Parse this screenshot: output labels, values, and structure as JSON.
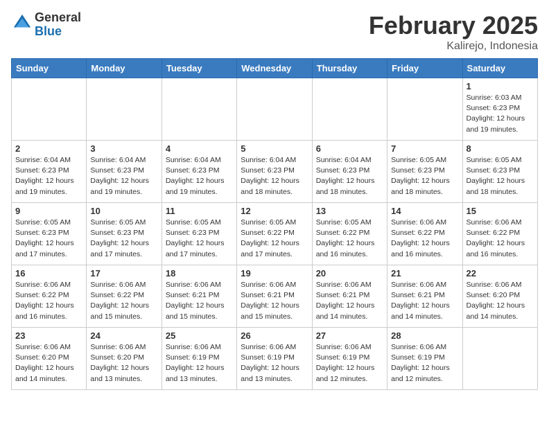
{
  "header": {
    "logo_line1": "General",
    "logo_line2": "Blue",
    "month_title": "February 2025",
    "location": "Kalirejo, Indonesia"
  },
  "days_of_week": [
    "Sunday",
    "Monday",
    "Tuesday",
    "Wednesday",
    "Thursday",
    "Friday",
    "Saturday"
  ],
  "weeks": [
    [
      {
        "day": "",
        "info": ""
      },
      {
        "day": "",
        "info": ""
      },
      {
        "day": "",
        "info": ""
      },
      {
        "day": "",
        "info": ""
      },
      {
        "day": "",
        "info": ""
      },
      {
        "day": "",
        "info": ""
      },
      {
        "day": "1",
        "info": "Sunrise: 6:03 AM\nSunset: 6:23 PM\nDaylight: 12 hours\nand 19 minutes."
      }
    ],
    [
      {
        "day": "2",
        "info": "Sunrise: 6:04 AM\nSunset: 6:23 PM\nDaylight: 12 hours\nand 19 minutes."
      },
      {
        "day": "3",
        "info": "Sunrise: 6:04 AM\nSunset: 6:23 PM\nDaylight: 12 hours\nand 19 minutes."
      },
      {
        "day": "4",
        "info": "Sunrise: 6:04 AM\nSunset: 6:23 PM\nDaylight: 12 hours\nand 19 minutes."
      },
      {
        "day": "5",
        "info": "Sunrise: 6:04 AM\nSunset: 6:23 PM\nDaylight: 12 hours\nand 18 minutes."
      },
      {
        "day": "6",
        "info": "Sunrise: 6:04 AM\nSunset: 6:23 PM\nDaylight: 12 hours\nand 18 minutes."
      },
      {
        "day": "7",
        "info": "Sunrise: 6:05 AM\nSunset: 6:23 PM\nDaylight: 12 hours\nand 18 minutes."
      },
      {
        "day": "8",
        "info": "Sunrise: 6:05 AM\nSunset: 6:23 PM\nDaylight: 12 hours\nand 18 minutes."
      }
    ],
    [
      {
        "day": "9",
        "info": "Sunrise: 6:05 AM\nSunset: 6:23 PM\nDaylight: 12 hours\nand 17 minutes."
      },
      {
        "day": "10",
        "info": "Sunrise: 6:05 AM\nSunset: 6:23 PM\nDaylight: 12 hours\nand 17 minutes."
      },
      {
        "day": "11",
        "info": "Sunrise: 6:05 AM\nSunset: 6:23 PM\nDaylight: 12 hours\nand 17 minutes."
      },
      {
        "day": "12",
        "info": "Sunrise: 6:05 AM\nSunset: 6:22 PM\nDaylight: 12 hours\nand 17 minutes."
      },
      {
        "day": "13",
        "info": "Sunrise: 6:05 AM\nSunset: 6:22 PM\nDaylight: 12 hours\nand 16 minutes."
      },
      {
        "day": "14",
        "info": "Sunrise: 6:06 AM\nSunset: 6:22 PM\nDaylight: 12 hours\nand 16 minutes."
      },
      {
        "day": "15",
        "info": "Sunrise: 6:06 AM\nSunset: 6:22 PM\nDaylight: 12 hours\nand 16 minutes."
      }
    ],
    [
      {
        "day": "16",
        "info": "Sunrise: 6:06 AM\nSunset: 6:22 PM\nDaylight: 12 hours\nand 16 minutes."
      },
      {
        "day": "17",
        "info": "Sunrise: 6:06 AM\nSunset: 6:22 PM\nDaylight: 12 hours\nand 15 minutes."
      },
      {
        "day": "18",
        "info": "Sunrise: 6:06 AM\nSunset: 6:21 PM\nDaylight: 12 hours\nand 15 minutes."
      },
      {
        "day": "19",
        "info": "Sunrise: 6:06 AM\nSunset: 6:21 PM\nDaylight: 12 hours\nand 15 minutes."
      },
      {
        "day": "20",
        "info": "Sunrise: 6:06 AM\nSunset: 6:21 PM\nDaylight: 12 hours\nand 14 minutes."
      },
      {
        "day": "21",
        "info": "Sunrise: 6:06 AM\nSunset: 6:21 PM\nDaylight: 12 hours\nand 14 minutes."
      },
      {
        "day": "22",
        "info": "Sunrise: 6:06 AM\nSunset: 6:20 PM\nDaylight: 12 hours\nand 14 minutes."
      }
    ],
    [
      {
        "day": "23",
        "info": "Sunrise: 6:06 AM\nSunset: 6:20 PM\nDaylight: 12 hours\nand 14 minutes."
      },
      {
        "day": "24",
        "info": "Sunrise: 6:06 AM\nSunset: 6:20 PM\nDaylight: 12 hours\nand 13 minutes."
      },
      {
        "day": "25",
        "info": "Sunrise: 6:06 AM\nSunset: 6:19 PM\nDaylight: 12 hours\nand 13 minutes."
      },
      {
        "day": "26",
        "info": "Sunrise: 6:06 AM\nSunset: 6:19 PM\nDaylight: 12 hours\nand 13 minutes."
      },
      {
        "day": "27",
        "info": "Sunrise: 6:06 AM\nSunset: 6:19 PM\nDaylight: 12 hours\nand 12 minutes."
      },
      {
        "day": "28",
        "info": "Sunrise: 6:06 AM\nSunset: 6:19 PM\nDaylight: 12 hours\nand 12 minutes."
      },
      {
        "day": "",
        "info": ""
      }
    ]
  ]
}
